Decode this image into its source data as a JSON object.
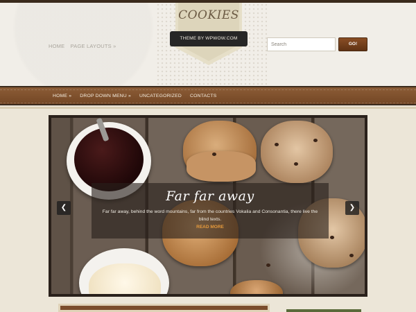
{
  "site": {
    "title": "COOKIES",
    "tagline": "THEME BY WPWOW.COM"
  },
  "top_nav": {
    "items": [
      "HOME",
      "PAGE LAYOUTS »"
    ]
  },
  "search": {
    "placeholder": "Search",
    "button_label": "GO!"
  },
  "main_nav": {
    "items": [
      "HOME »",
      "DROP DOWN MENU »",
      "UNCATEGORIZED",
      "CONTACTS"
    ]
  },
  "slider": {
    "title": "Far far away",
    "text": "Far far away, behind the word mountains, far from the countries Vokalia and Consonantia, there live the blind texts.",
    "more_label": "READ MORE",
    "prev_icon": "chevron-left-icon",
    "next_icon": "chevron-right-icon"
  },
  "colors": {
    "accent": "#7a4a25",
    "nav_bg": "#8b5c36",
    "button": "#6b3a18",
    "read_more": "#e69a3c"
  }
}
